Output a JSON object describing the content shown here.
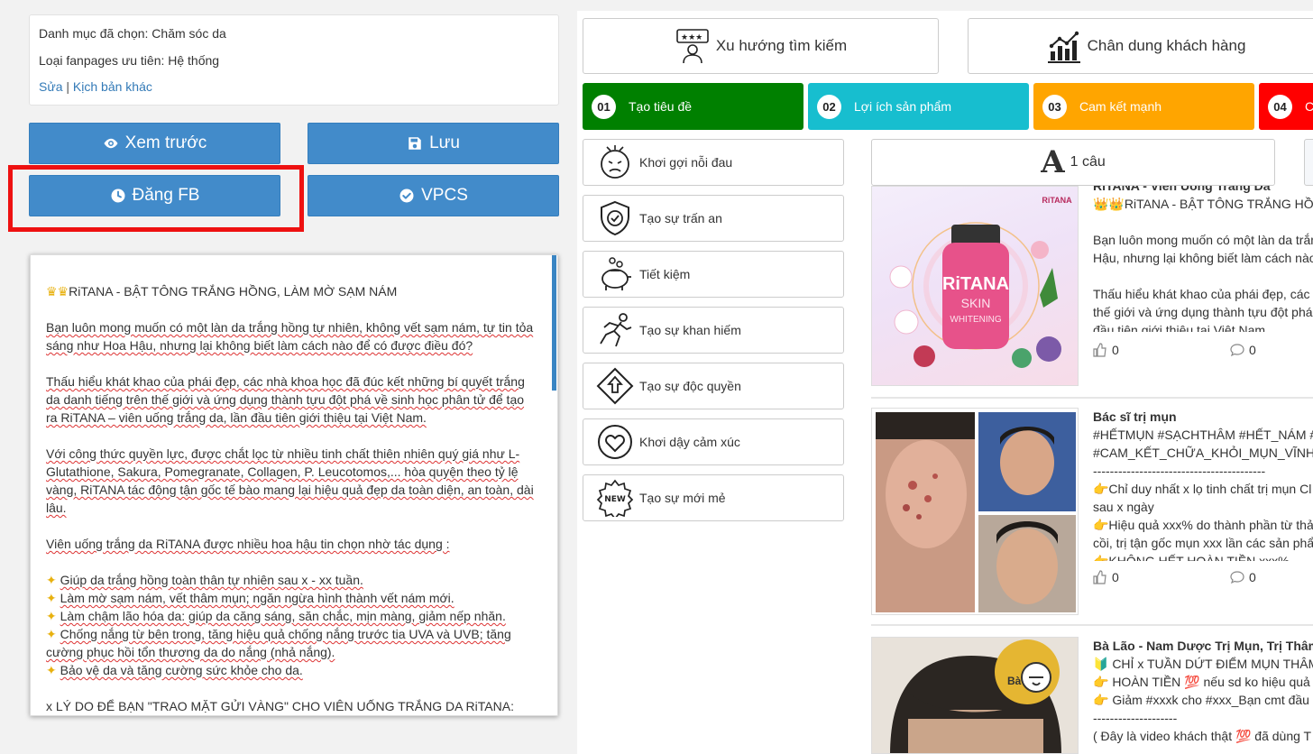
{
  "info": {
    "category_label": "Danh mục đã chọn: Chăm sóc da",
    "fanpage_label": "Loại fanpages ưu tiên: Hệ thống",
    "edit_link": "Sửa",
    "separator": " | ",
    "other_script_link": "Kịch bản khác"
  },
  "buttons": {
    "preview": "Xem trước",
    "save": "Lưu",
    "post_fb": "Đăng FB",
    "vpcs": "VPCS"
  },
  "editor": {
    "title_line": "RiTANA - BẬT TÔNG TRẮNG HỒNG, LÀM MỜ SẠM NÁM",
    "para1": "Bạn luôn mong muốn có một làn da trắng hồng tự nhiên, không vết sạm nám, tự tin tỏa sáng như Hoa Hậu, nhưng lại không biết làm cách nào để có được điều đó?",
    "para2": "Thấu hiểu khát khao của phái đẹp, các nhà khoa học đã đúc kết những bí quyết trắng da danh tiếng trên thế giới và ứng dụng thành tựu đột phá về sinh học phân tử để tạo ra RiTANA – viên uống trắng da, lần đầu tiên giới thiệu tại Việt Nam.",
    "para3": "Với công thức quyền lực, được chắt lọc từ nhiều tinh chất thiên nhiên quý giá như L-Glutathione, Sakura, Pomegranate, Collagen, P. Leucotomos,... hòa quyện theo tỷ lệ vàng, RiTANA tác động tận gốc tế bào mang lại hiệu quả đẹp da toàn diện, an toàn, dài lâu.",
    "para4": "Viên uống trắng da RiTANA được nhiều hoa hậu tin chọn nhờ tác dụng :",
    "bullets": [
      "Giúp da trắng hồng toàn thân tự nhiên sau x - xx tuần.",
      "Làm mờ sạm nám, vết thâm mụn; ngăn ngừa hình thành vết nám mới.",
      "Làm chậm lão hóa da: giúp da căng sáng, săn chắc, mịn màng, giảm nếp nhăn.",
      "Chống nắng từ bên trong,  tăng hiệu quả chống nắng trước tia UVA và UVB; tăng cường phục hồi tổn thương da do nắng (nhả nắng).",
      "Bảo vệ da và tăng cường sức khỏe cho da."
    ],
    "para5": "x LÝ DO ĐỂ BẠN \"TRAO MẶT GỬI VÀNG\" CHO VIÊN UỐNG TRẮNG DA RiTANA:"
  },
  "top_cards": {
    "trends": "Xu hướng tìm kiếm",
    "persona": "Chân dung khách hàng"
  },
  "steps": [
    {
      "num": "01",
      "label": "Tạo tiêu đề",
      "color": "#008000"
    },
    {
      "num": "02",
      "label": "Lợi ích sản phẩm",
      "color": "#17becf"
    },
    {
      "num": "03",
      "label": "Cam kết mạnh",
      "color": "#ffa500"
    },
    {
      "num": "04",
      "label": "C",
      "color": "#ff0000"
    }
  ],
  "categories": [
    {
      "label": "Khơi gợi nỗi đau",
      "icon": "pain-face-icon"
    },
    {
      "label": "Tạo sự trấn an",
      "icon": "shield-check-icon"
    },
    {
      "label": "Tiết kiệm",
      "icon": "piggy-bank-icon"
    },
    {
      "label": "Tạo sự khan hiếm",
      "icon": "running-man-icon"
    },
    {
      "label": "Tạo sự độc quyền",
      "icon": "arrow-up-diamond-icon"
    },
    {
      "label": "Khơi dậy cảm xúc",
      "icon": "heart-icon"
    },
    {
      "label": "Tạo sự mới mẻ",
      "icon": "new-badge-icon"
    }
  ],
  "length": {
    "big_letter": "A",
    "label": "1 câu"
  },
  "posts": [
    {
      "title": "RiTANA - Viên Uống Trắng Da",
      "lines": [
        "👑👑RiTANA - BẬT TÔNG TRẮNG HỒNG",
        "",
        "Bạn luôn mong muốn có một làn da trắng",
        "Hậu, nhưng lại không biết làm cách nào",
        "",
        "Thấu hiểu khát khao của phái đẹp, các",
        "thế giới và ứng dụng thành tựu đột phá",
        "đầu tiên giới thiệu tại Việt Nam"
      ],
      "likes": "0",
      "comments": "0",
      "image_label": "RiTANA SKIN WHITENING"
    },
    {
      "title": "Bác sĩ trị mụn",
      "lines": [
        "#HẾTMỤN #SẠCHTHÂM #HẾT_NÁM #",
        "#CAM_KẾT_CHỮA_KHỎI_MỤN_VĨNH",
        "-----------------------------------------",
        "👉Chỉ duy nhất x lọ tinh chất trị mụn Cl",
        "sau x ngày",
        "👉Hiệu quả xxx% do thành phần từ thả",
        "cồi, trị tận gốc mụn xxx lần các sản phẩ",
        "👉KHÔNG HẾT HOÀN TIỀN xxx%"
      ],
      "likes": "0",
      "comments": "0"
    },
    {
      "title": "Bà Lão - Nam Dược Trị Mụn, Trị Thâm",
      "lines": [
        "🔰 CHỈ x TUẦN DỨT ĐIỂM MỤN THÂM",
        "👉 HOÀN TIỀN 💯 nếu sd ko hiệu quả",
        "👉 Giảm #xxxk cho #xxx_Bạn cmt đầu",
        "--------------------",
        "( Đây là video khách thật 💯 đã dùng T"
      ]
    }
  ],
  "colors": {
    "primary_button": "#428bca",
    "highlight_border": "#ee1111",
    "step1": "#008000",
    "step2": "#17becf",
    "step3": "#ffa500",
    "step4": "#ff0000"
  }
}
